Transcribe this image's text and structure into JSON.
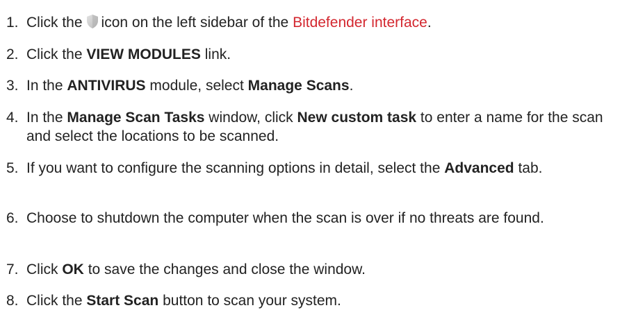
{
  "steps": [
    {
      "number": "1.",
      "pre": "Click the",
      "icon": "shield-icon",
      "mid": "icon on the left sidebar of the",
      "link": "Bitdefender interface",
      "post": "."
    },
    {
      "number": "2.",
      "pre": "Click the",
      "bold": "VIEW MODULES",
      "post": "link."
    },
    {
      "number": "3.",
      "pre": "In the",
      "bold1": "ANTIVIRUS",
      "mid": "module, select",
      "bold2": "Manage Scans",
      "post": "."
    },
    {
      "number": "4.",
      "pre": "In the",
      "bold1": "Manage Scan Tasks",
      "mid": "window, click",
      "bold2": "New custom task",
      "post": "to enter a name for the scan and select the locations to be scanned."
    },
    {
      "number": "5.",
      "pre": "If you want to configure the scanning options in detail, select the",
      "bold": "Advanced",
      "post": "tab."
    },
    {
      "number": "6.",
      "text": "Choose to shutdown the computer when the scan is over if no threats are found."
    },
    {
      "number": "7.",
      "pre": "Click",
      "bold": "OK",
      "post": "to save the changes and close the window."
    },
    {
      "number": "8.",
      "pre": "Click the",
      "bold": "Start Scan",
      "post": "button to scan your system."
    }
  ],
  "colors": {
    "text": "#222222",
    "link": "#d3272f",
    "icon": "#c8c8c8"
  }
}
